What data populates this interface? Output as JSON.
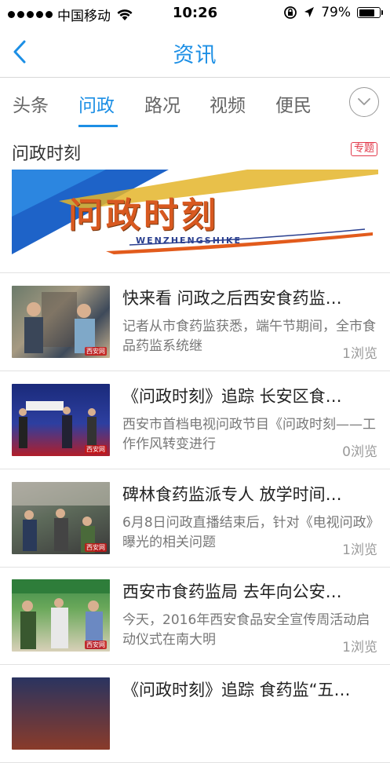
{
  "status_bar": {
    "carrier": "中国移动",
    "time": "10:26",
    "battery_percent": "79%",
    "battery_level": 0.79
  },
  "navbar": {
    "back_icon": "chevron-left-icon",
    "title": "资讯"
  },
  "tabs": {
    "items": [
      {
        "label": "头条",
        "active": false
      },
      {
        "label": "问政",
        "active": true
      },
      {
        "label": "路况",
        "active": false
      },
      {
        "label": "视频",
        "active": false
      },
      {
        "label": "便民",
        "active": false
      }
    ],
    "more_icon": "chevron-down-circle-icon"
  },
  "topic": {
    "title": "问政时刻",
    "badge": "专题",
    "banner_text": "问政时刻",
    "banner_sub": "WENZHENGSHIKE"
  },
  "news": [
    {
      "title": "快来看 问政之后西安食药监…",
      "summary": "记者从市食药监获悉，端午节期间，全市食品药监系统继",
      "views": "1浏览"
    },
    {
      "title": "《问政时刻》追踪 长安区食…",
      "summary": "西安市首档电视问政节目《问政时刻——工作作风转变进行",
      "views": "0浏览"
    },
    {
      "title": "碑林食药监派专人 放学时间…",
      "summary": "6月8日问政直播结束后，针对《电视问政》曝光的相关问题",
      "views": "1浏览"
    },
    {
      "title": "西安市食药监局 去年向公安…",
      "summary": "今天，2016年西安食品安全宣传周活动启动仪式在南大明",
      "views": "1浏览"
    },
    {
      "title": "《问政时刻》追踪 食药监“五…",
      "summary": "",
      "views": ""
    }
  ],
  "colors": {
    "accent": "#1c8fe5",
    "badge": "#e23a4b"
  }
}
